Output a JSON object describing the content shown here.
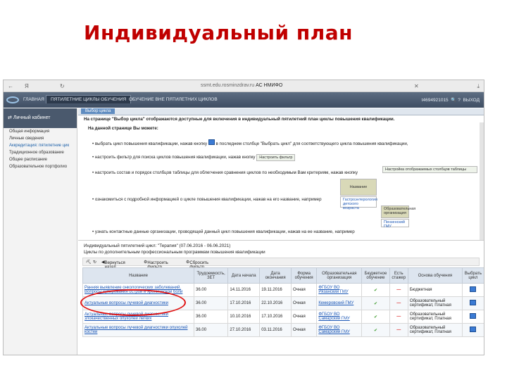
{
  "slide_title": "Индивидуальный план",
  "browser": {
    "back": "←",
    "y_mark": "Я",
    "url_domain": "ssmt.edu.rosminzdrav.ru",
    "url_title": "АС НМИФО"
  },
  "header": {
    "nav": [
      "ГЛАВНАЯ",
      "ПЯТИЛЕТНИЕ ЦИКЛЫ ОБУЧЕНИЯ",
      "ОБУЧЕНИЕ ВНЕ ПЯТИЛЕТНИХ ЦИКЛОВ"
    ],
    "user_id": "t4694921015",
    "logout": "ВЫХОД"
  },
  "sidebar": {
    "title": "Личный кабинет",
    "items": [
      "Общая информация",
      "Личные сведения",
      "Аккредитация: пятилетние цик",
      "Традиционное образование",
      "Общее расписание",
      "Образовательное портфолио"
    ]
  },
  "tab": "Выбор цикла",
  "info": {
    "intro": "На странице \"Выбор цикла\" отображаются доступные для включения в индивидуальный пятилетний план циклы повышения квалификации.",
    "can_do": "На данной странице Вы можете:",
    "b1": "выбрать цикл повышения квалификации, нажав кнопку",
    "b1b": "в последнем столбце \"Выбрать цикл\" для соответствующего цикла повышения квалификации,",
    "b2": "настроить фильтр для поиска циклов повышения квалификации, нажав кнопку",
    "filter_btn": "Настроить фильтр",
    "b3": "настроить состав и порядок столбцов таблицы для облегчения сравнения циклов по необходимым Вам критериям, нажав кнопку",
    "cols_btn": "Настройка отображаемых столбцов таблицы",
    "name_hdr": "Название",
    "name_val": "Гастроэнтерология детского возраста",
    "b4": "ознакомиться с подробной информацией о цикле повышения квалификации, нажав на его название, например",
    "org_hdr": "Образовательная организация",
    "org_val": "Пензенский ГМУ",
    "b5": "узнать контактные данные организации, проводящей данный цикл повышения квалификации, нажав на ее название, например"
  },
  "plan_label": "Индивидуальный пятилетний цикл: \"Терапия\" (07.06.2016 - 06.06.2021)",
  "cycles_label": "Циклы по дополнительным профессиональным программам повышения квалификации",
  "toolbar": {
    "back": "Вернуться назад",
    "filter": "Настроить фильтр",
    "reset": "Сбросить фильтр"
  },
  "table": {
    "headers": [
      "Название",
      "Трудоемкость, ЗЕТ",
      "Дата начала",
      "Дата окончания",
      "Форма обучения",
      "Образовательная организация",
      "Бюджетное обучение",
      "Есть стажер",
      "Основа обучения",
      "Выбрать цикл"
    ],
    "rows": [
      {
        "name": "Ранняя выявление онкологических заболеваний. Вопросы купирования острой и хронической боли",
        "zet": "36.00",
        "start": "14.11.2016",
        "end": "19.11.2016",
        "form": "Очная",
        "org": "ФГБОУ ВО Рязанский ГМУ",
        "budget": "✔",
        "stager": "—",
        "basis": "Бюджетная"
      },
      {
        "name": "Актуальные вопросы лучевой диагностики",
        "zet": "36.00",
        "start": "17.10.2016",
        "end": "22.10.2016",
        "form": "Очная",
        "org": "Кемеровский ГМУ",
        "budget": "✔",
        "stager": "—",
        "basis": "Образовательный сертификат, Платная"
      },
      {
        "name": "Актуальные вопросы лучевой диагностики злокачественных опухолей легких",
        "zet": "36.00",
        "start": "10.10.2016",
        "end": "17.10.2016",
        "form": "Очная",
        "org": "ФГБОУ ВО Самарский ГМУ",
        "budget": "✔",
        "stager": "—",
        "basis": "Образовательный сертификат, Платная"
      },
      {
        "name": "Актуальные вопросы лучевой диагностики опухолей костей",
        "zet": "36.00",
        "start": "27.10.2016",
        "end": "03.11.2016",
        "form": "Очная",
        "org": "ФГБОУ ВО Самарский ГМУ",
        "budget": "✔",
        "stager": "—",
        "basis": "Образовательный сертификат, Платная"
      }
    ]
  },
  "colors": {
    "title": "#c00000",
    "header": "#4a596d",
    "highlight": "#e01010"
  }
}
